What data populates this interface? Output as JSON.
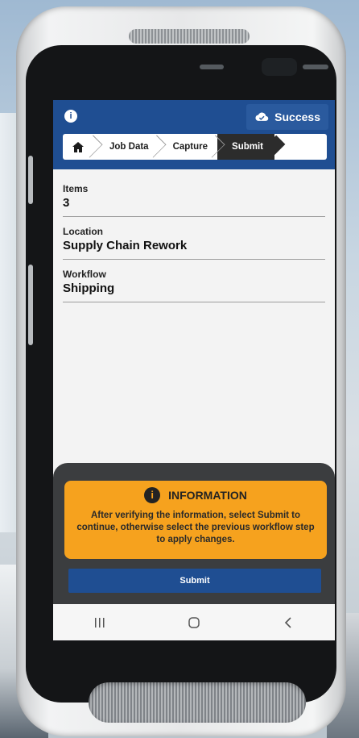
{
  "header": {
    "status_label": "Success"
  },
  "breadcrumb": {
    "items": [
      {
        "label": "Job Data"
      },
      {
        "label": "Capture"
      },
      {
        "label": "Submit",
        "active": true
      }
    ]
  },
  "fields": [
    {
      "label": "Items",
      "value": "3"
    },
    {
      "label": "Location",
      "value": "Supply Chain Rework"
    },
    {
      "label": "Workflow",
      "value": "Shipping"
    }
  ],
  "info": {
    "title": "INFORMATION",
    "message": "After verifying the information, select Submit to continue, otherwise select the previous workflow step to apply changes."
  },
  "actions": {
    "submit_label": "Submit"
  },
  "icons": {
    "info": "info-icon",
    "status": "cloud-check-icon",
    "home": "home-icon",
    "nav_recent": "recent-apps-icon",
    "nav_home": "home-button-icon",
    "nav_back": "back-icon"
  },
  "colors": {
    "header": "#1f4e92",
    "info_card": "#f6a21e",
    "panel": "#3b3d3f",
    "active_crumb": "#2c2c2c"
  }
}
